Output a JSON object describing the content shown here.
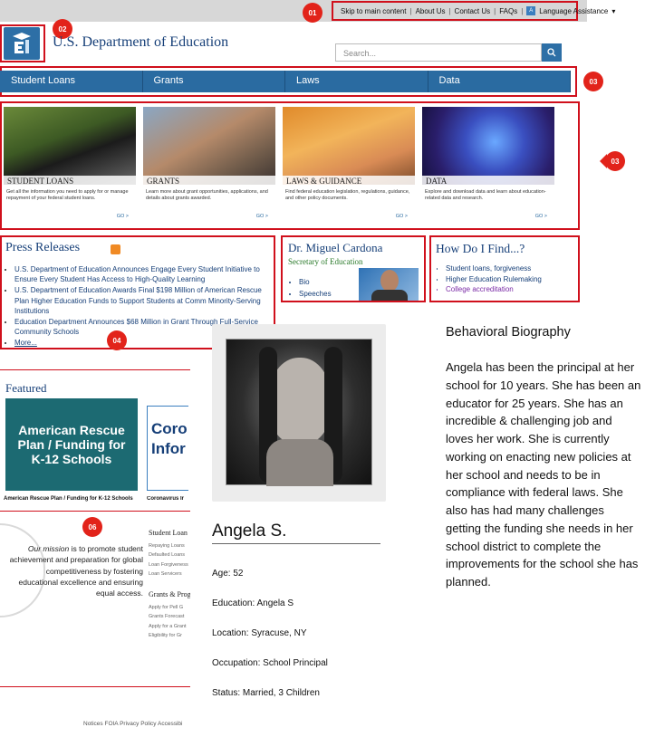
{
  "markers": {
    "m01": "01",
    "m02": "02",
    "m03a": "03",
    "m03b": "03",
    "m04": "04",
    "m06": "06"
  },
  "utility_nav": [
    "Skip to main content",
    "About Us",
    "Contact Us",
    "FAQs",
    "Language Assistance"
  ],
  "header": {
    "agency_name": "U.S. Department of Education",
    "search_placeholder": "Search..."
  },
  "main_nav": [
    "Student Loans",
    "Grants",
    "Laws",
    "Data"
  ],
  "cards": [
    {
      "caption": "STUDENT LOANS",
      "description": "Get all the information you need to apply for or manage repayment of your federal student loans.",
      "go": "GO >"
    },
    {
      "caption": "GRANTS",
      "description": "Learn more about grant opportunities, applications, and details about grants awarded.",
      "go": "GO >"
    },
    {
      "caption": "LAWS & GUIDANCE",
      "description": "Find federal education legislation, regulations, guidance, and other policy documents.",
      "go": "GO >"
    },
    {
      "caption": "DATA",
      "description": "Explore and download data and learn about education-related data and research.",
      "go": "GO >"
    }
  ],
  "press": {
    "title": "Press Releases",
    "items": [
      "U.S. Department of Education Announces Engage Every Student Initiative to Ensure Every Student Has Access to High-Quality Learning",
      "U.S. Department of Education Awards Final $198 Million of American Rescue Plan Higher Education Funds to Support Students at Comm",
      "Education Department Announces $68 Million in Grant",
      "More..."
    ],
    "item2_line2": "Minority-Serving Institutions",
    "item3_line2": "Through Full-Service Community Schools"
  },
  "secretary": {
    "name": "Dr. Miguel Cardona",
    "title": "Secretary of Education",
    "links": [
      "Bio",
      "Speeches"
    ]
  },
  "howdoi": {
    "title": "How Do I Find...?",
    "links": [
      "Student loans, forgiveness",
      "Higher Education Rulemaking",
      "College accreditation"
    ]
  },
  "featured": {
    "title": "Featured",
    "tile1_text": "American Rescue Plan / Funding for K-12 Schools",
    "tile1_caption": "American Rescue Plan / Funding for K-12 Schools",
    "tile2_text": "Coro Infor",
    "tile2_caption": "Coronavirus Ir"
  },
  "mission": {
    "emphasis": "Our mission",
    "text": " is to promote student achievement and preparation for global competitiveness by fostering educational excellence and ensuring equal access."
  },
  "footer_links": {
    "group1_title": "Student Loan",
    "group1": [
      "Repaying Loans",
      "Defaulted Loans",
      "Loan Forgiveness",
      "Loan Servicers"
    ],
    "group2_title": "Grants & Prog",
    "group2": [
      "Apply for Pell G",
      "Grants Forecast",
      "Apply for a Grant",
      "Eligibility for Gr"
    ]
  },
  "bottom_footer": "Notices  FOIA  Privacy Policy  Accessibi",
  "persona": {
    "name": "Angela S.",
    "fields": [
      "Age: 52",
      "Education: Angela S",
      "Location: Syracuse, NY",
      "Occupation: School Principal",
      "Status: Married, 3 Children"
    ],
    "bio_heading": "Behavioral Biography",
    "bio": "Angela has been the principal at her school for 10 years. She has been an educator for 25 years. She has an incredible & challenging job and loves her work. She is currently working on enacting new policies at her school and needs to be in compliance with federal laws. She also has had many challenges getting the funding she needs in her school district to complete the improvements for the school she has planned."
  },
  "colors": {
    "brand_blue": "#2a6ba1",
    "marker_red": "#e2231a",
    "heading_navy": "#163f78"
  }
}
